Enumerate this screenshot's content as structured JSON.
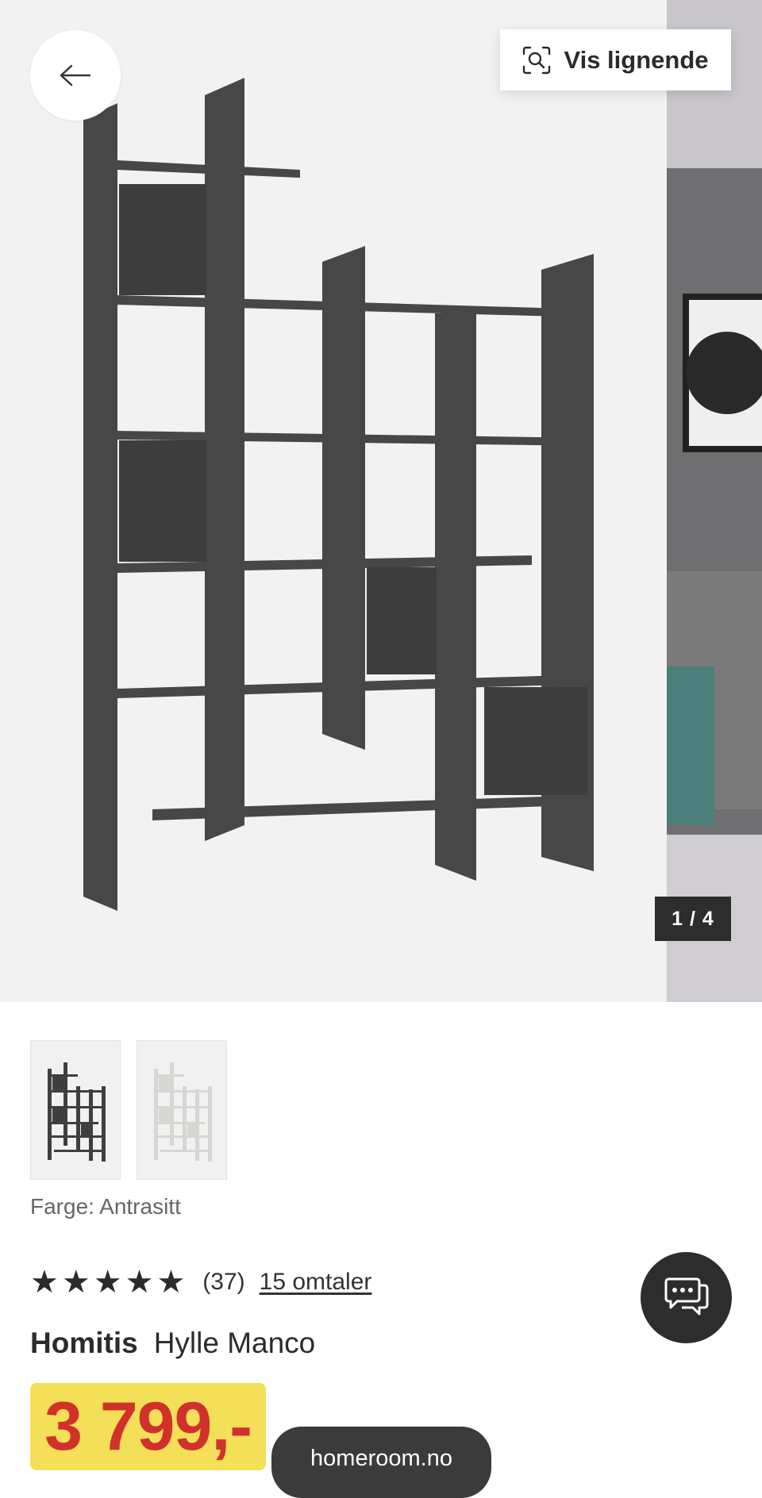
{
  "gallery": {
    "similar_label": "Vis lignende",
    "counter": "1 / 4",
    "current_image": 1,
    "total_images": 4
  },
  "thumbnails": [
    {
      "name": "Antrasitt"
    },
    {
      "name": "Hvit"
    }
  ],
  "product": {
    "color_label": "Farge: Antrasitt",
    "rating_value": 5,
    "rating_count": "(37)",
    "reviews_link": "15 omtaler",
    "brand": "Homitis",
    "name": "Hylle Manco",
    "price": "3 799,-"
  },
  "browser": {
    "url": "homeroom.no"
  },
  "colors": {
    "price_badge": "#f3df58",
    "price_text": "#d0312a",
    "dark_button": "#2d2d2d",
    "shelf": "#474748"
  },
  "icons": {
    "back": "arrow-left-icon",
    "similar": "visual-search-icon",
    "chat": "chat-bubbles-icon",
    "star": "star-icon"
  }
}
